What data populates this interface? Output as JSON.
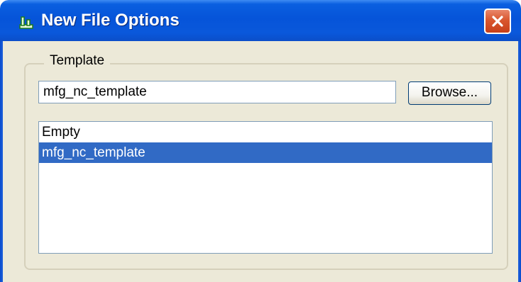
{
  "window": {
    "title": "New File Options",
    "icon": "green-new-file-icon",
    "close_icon": "close-icon"
  },
  "template_group": {
    "legend": "Template",
    "input_value": "mfg_nc_template",
    "browse_label": "Browse...",
    "items": [
      {
        "label": "Empty",
        "selected": false
      },
      {
        "label": "mfg_nc_template",
        "selected": true
      }
    ]
  },
  "colors": {
    "titlebar": "#0654d9",
    "selection": "#316ac5",
    "close_button": "#d9572f",
    "dialog_background": "#ece9d8"
  }
}
